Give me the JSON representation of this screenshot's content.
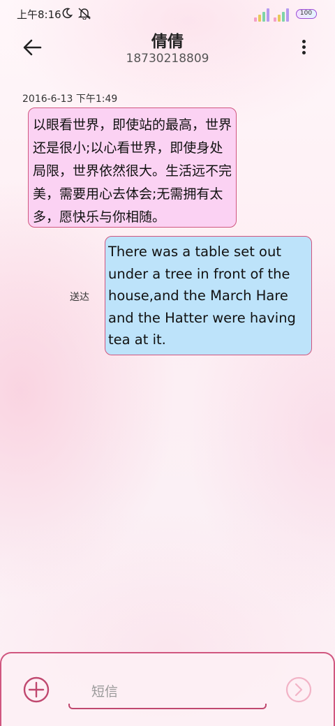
{
  "status_bar": {
    "time": "上午8:16",
    "battery": "100",
    "icons": [
      "moon-icon",
      "bell-off-icon",
      "signal-icon",
      "battery-icon"
    ]
  },
  "header": {
    "contact_name": "倩倩",
    "contact_number": "18730218809",
    "back_icon": "arrow-left-icon",
    "more_icon": "more-vertical-icon"
  },
  "conversation": {
    "timestamp": "2016-6-13 下午1:49",
    "messages": [
      {
        "direction": "incoming",
        "text": "以眼看世界，即使站的最高，世界还是很小;以心看世界，即使身处局限，世界依然很大。生活远不完美，需要用心去体会;无需拥有太多，愿快乐与你相随。"
      },
      {
        "direction": "outgoing",
        "text": "There was a table set out under a tree in front of the house,and the March Hare and the Hatter were having tea at it.",
        "status": "送达"
      }
    ]
  },
  "composer": {
    "placeholder": "短信",
    "add_icon": "plus-circle-icon",
    "send_icon": "send-arrow-icon"
  },
  "colors": {
    "accent": "#d0567f",
    "incoming_bubble": "#fbd2f3",
    "outgoing_bubble": "#bde3fa"
  }
}
